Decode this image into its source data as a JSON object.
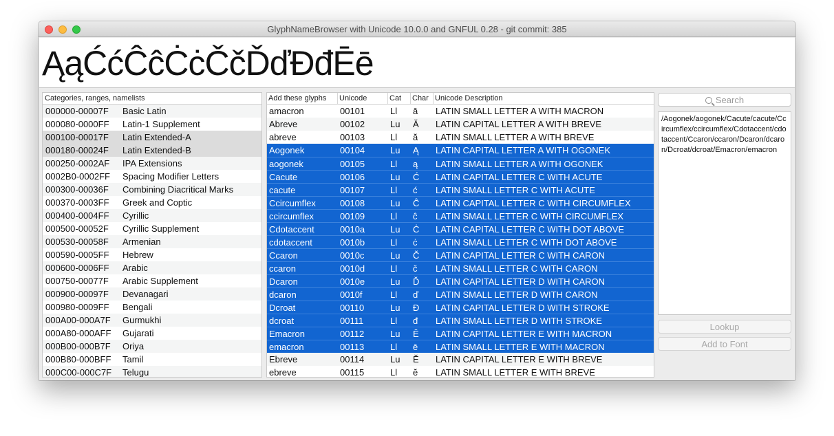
{
  "window": {
    "title": "GlyphNameBrowser with Unicode 10.0.0 and GNFUL 0.28 - git commit: 385"
  },
  "preview": {
    "text": "ĄąĆćĈĉĊċČčĎďĐđĒē"
  },
  "categories": {
    "header": "Categories, ranges, namelists",
    "items": [
      {
        "range": "000000-00007F",
        "name": "Basic Latin"
      },
      {
        "range": "000080-0000FF",
        "name": "Latin-1 Supplement"
      },
      {
        "range": "000100-00017F",
        "name": "Latin Extended-A"
      },
      {
        "range": "000180-00024F",
        "name": "Latin Extended-B"
      },
      {
        "range": "000250-0002AF",
        "name": "IPA Extensions"
      },
      {
        "range": "0002B0-0002FF",
        "name": "Spacing Modifier Letters"
      },
      {
        "range": "000300-00036F",
        "name": "Combining Diacritical Marks"
      },
      {
        "range": "000370-0003FF",
        "name": "Greek and Coptic"
      },
      {
        "range": "000400-0004FF",
        "name": "Cyrillic"
      },
      {
        "range": "000500-00052F",
        "name": "Cyrillic Supplement"
      },
      {
        "range": "000530-00058F",
        "name": "Armenian"
      },
      {
        "range": "000590-0005FF",
        "name": "Hebrew"
      },
      {
        "range": "000600-0006FF",
        "name": "Arabic"
      },
      {
        "range": "000750-00077F",
        "name": "Arabic Supplement"
      },
      {
        "range": "000900-00097F",
        "name": "Devanagari"
      },
      {
        "range": "000980-0009FF",
        "name": "Bengali"
      },
      {
        "range": "000A00-000A7F",
        "name": "Gurmukhi"
      },
      {
        "range": "000A80-000AFF",
        "name": "Gujarati"
      },
      {
        "range": "000B00-000B7F",
        "name": "Oriya"
      },
      {
        "range": "000B80-000BFF",
        "name": "Tamil"
      },
      {
        "range": "000C00-000C7F",
        "name": "Telugu"
      }
    ]
  },
  "glyph_table": {
    "headers": {
      "name": "Add these glyphs",
      "unicode": "Unicode",
      "cat": "Cat",
      "char": "Char",
      "desc": "Unicode Description"
    },
    "rows": [
      {
        "name": "amacron",
        "unicode": "00101",
        "cat": "Ll",
        "char": "ā",
        "desc": "LATIN SMALL LETTER A WITH MACRON",
        "selected": false
      },
      {
        "name": "Abreve",
        "unicode": "00102",
        "cat": "Lu",
        "char": "Ă",
        "desc": "LATIN CAPITAL LETTER A WITH BREVE",
        "selected": false
      },
      {
        "name": "abreve",
        "unicode": "00103",
        "cat": "Ll",
        "char": "ă",
        "desc": "LATIN SMALL LETTER A WITH BREVE",
        "selected": false
      },
      {
        "name": "Aogonek",
        "unicode": "00104",
        "cat": "Lu",
        "char": "Ą",
        "desc": "LATIN CAPITAL LETTER A WITH OGONEK",
        "selected": true
      },
      {
        "name": "aogonek",
        "unicode": "00105",
        "cat": "Ll",
        "char": "ą",
        "desc": "LATIN SMALL LETTER A WITH OGONEK",
        "selected": true
      },
      {
        "name": "Cacute",
        "unicode": "00106",
        "cat": "Lu",
        "char": "Ć",
        "desc": "LATIN CAPITAL LETTER C WITH ACUTE",
        "selected": true
      },
      {
        "name": "cacute",
        "unicode": "00107",
        "cat": "Ll",
        "char": "ć",
        "desc": "LATIN SMALL LETTER C WITH ACUTE",
        "selected": true
      },
      {
        "name": "Ccircumflex",
        "unicode": "00108",
        "cat": "Lu",
        "char": "Ĉ",
        "desc": "LATIN CAPITAL LETTER C WITH CIRCUMFLEX",
        "selected": true
      },
      {
        "name": "ccircumflex",
        "unicode": "00109",
        "cat": "Ll",
        "char": "ĉ",
        "desc": "LATIN SMALL LETTER C WITH CIRCUMFLEX",
        "selected": true
      },
      {
        "name": "Cdotaccent",
        "unicode": "0010a",
        "cat": "Lu",
        "char": "Ċ",
        "desc": "LATIN CAPITAL LETTER C WITH DOT ABOVE",
        "selected": true
      },
      {
        "name": "cdotaccent",
        "unicode": "0010b",
        "cat": "Ll",
        "char": "ċ",
        "desc": "LATIN SMALL LETTER C WITH DOT ABOVE",
        "selected": true
      },
      {
        "name": "Ccaron",
        "unicode": "0010c",
        "cat": "Lu",
        "char": "Č",
        "desc": "LATIN CAPITAL LETTER C WITH CARON",
        "selected": true
      },
      {
        "name": "ccaron",
        "unicode": "0010d",
        "cat": "Ll",
        "char": "č",
        "desc": "LATIN SMALL LETTER C WITH CARON",
        "selected": true
      },
      {
        "name": "Dcaron",
        "unicode": "0010e",
        "cat": "Lu",
        "char": "Ď",
        "desc": "LATIN CAPITAL LETTER D WITH CARON",
        "selected": true
      },
      {
        "name": "dcaron",
        "unicode": "0010f",
        "cat": "Ll",
        "char": "ď",
        "desc": "LATIN SMALL LETTER D WITH CARON",
        "selected": true
      },
      {
        "name": "Dcroat",
        "unicode": "00110",
        "cat": "Lu",
        "char": "Đ",
        "desc": "LATIN CAPITAL LETTER D WITH STROKE",
        "selected": true
      },
      {
        "name": "dcroat",
        "unicode": "00111",
        "cat": "Ll",
        "char": "đ",
        "desc": "LATIN SMALL LETTER D WITH STROKE",
        "selected": true
      },
      {
        "name": "Emacron",
        "unicode": "00112",
        "cat": "Lu",
        "char": "Ē",
        "desc": "LATIN CAPITAL LETTER E WITH MACRON",
        "selected": true
      },
      {
        "name": "emacron",
        "unicode": "00113",
        "cat": "Ll",
        "char": "ē",
        "desc": "LATIN SMALL LETTER E WITH MACRON",
        "selected": true
      },
      {
        "name": "Ebreve",
        "unicode": "00114",
        "cat": "Lu",
        "char": "Ĕ",
        "desc": "LATIN CAPITAL LETTER E WITH BREVE",
        "selected": false
      },
      {
        "name": "ebreve",
        "unicode": "00115",
        "cat": "Ll",
        "char": "ĕ",
        "desc": "LATIN SMALL LETTER E WITH BREVE",
        "selected": false
      }
    ]
  },
  "search": {
    "placeholder": "Search",
    "icon": "search-icon"
  },
  "names_output": "/Aogonek/aogonek/Cacute/cacute/Ccircumflex/ccircumflex/Cdotaccent/cdotaccent/Ccaron/ccaron/Dcaron/dcaron/Dcroat/dcroat/Emacron/emacron",
  "buttons": {
    "lookup": "Lookup",
    "add_to_font": "Add to Font"
  },
  "colors": {
    "selection": "#1265d1",
    "category_selection": "#dcdcdc"
  }
}
